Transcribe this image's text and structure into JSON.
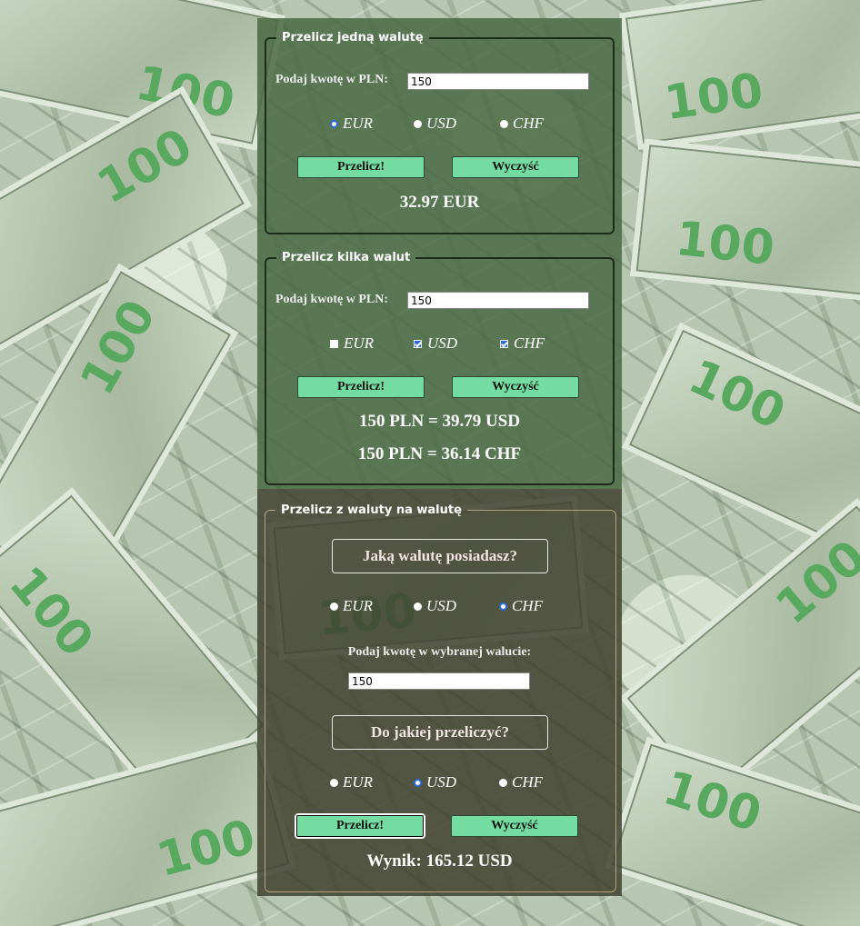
{
  "section1": {
    "legend": "Przelicz jedną walutę",
    "amount_label": "Podaj kwotę w PLN:",
    "amount_value": "150",
    "options": [
      {
        "label": "EUR",
        "selected": true
      },
      {
        "label": "USD",
        "selected": false
      },
      {
        "label": "CHF",
        "selected": false
      }
    ],
    "convert_label": "Przelicz!",
    "clear_label": "Wyczyść",
    "result": "32.97 EUR"
  },
  "section2": {
    "legend": "Przelicz kilka walut",
    "amount_label": "Podaj kwotę w PLN:",
    "amount_value": "150",
    "options": [
      {
        "label": "EUR",
        "checked": false
      },
      {
        "label": "USD",
        "checked": true
      },
      {
        "label": "CHF",
        "checked": true
      }
    ],
    "convert_label": "Przelicz!",
    "clear_label": "Wyczyść",
    "results": [
      "150 PLN = 39.79 USD",
      "150 PLN = 36.14 CHF"
    ]
  },
  "section3": {
    "legend": "Przelicz z waluty na walutę",
    "question_have": "Jaką walutę posiadasz?",
    "from_options": [
      {
        "label": "EUR",
        "selected": false
      },
      {
        "label": "USD",
        "selected": false
      },
      {
        "label": "CHF",
        "selected": true
      }
    ],
    "amount_label": "Podaj kwotę w wybranej walucie:",
    "amount_value": "150",
    "question_to": "Do jakiej przeliczyć?",
    "to_options": [
      {
        "label": "EUR",
        "selected": false
      },
      {
        "label": "USD",
        "selected": true
      },
      {
        "label": "CHF",
        "selected": false
      }
    ],
    "convert_label": "Przelicz!",
    "clear_label": "Wyczyść",
    "result": "Wynik: 165.12 USD"
  },
  "colors": {
    "button": "#74dca0",
    "panel_green": "#4a6a44",
    "panel_dark": "#404230",
    "radio_selected": "#2b6de0"
  }
}
